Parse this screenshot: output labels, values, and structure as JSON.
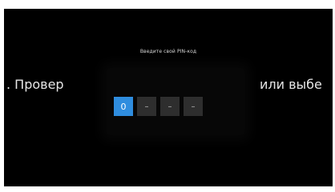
{
  "pin_dialog": {
    "title": "Введите свой PIN-код",
    "digits": [
      "0",
      "–",
      "–",
      "–"
    ]
  },
  "background_text": {
    "left": ". Провер",
    "right": "или выбе"
  },
  "colors": {
    "screen_background": "#000000",
    "active_digit_box": "#2f8ddf",
    "inactive_digit_box": "#2e2e2e"
  }
}
